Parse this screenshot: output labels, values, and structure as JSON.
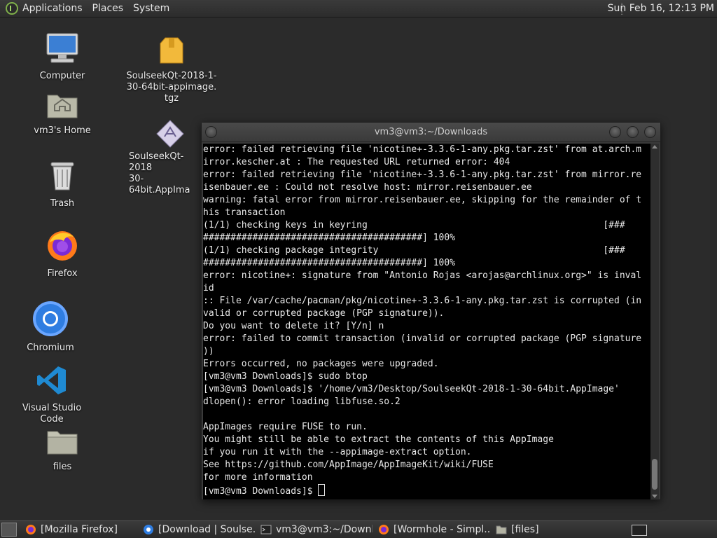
{
  "top_panel": {
    "menus": [
      "Applications",
      "Places",
      "System"
    ],
    "clock": "Sun Feb 16, 12:13 PM"
  },
  "desktop": {
    "computer": "Computer",
    "home": "vm3's Home",
    "trash": "Trash",
    "firefox": "Firefox",
    "chromium": "Chromium",
    "vscode": "Visual Studio Code",
    "files": "files",
    "tgz_line1": "SoulseekQt-2018-1-",
    "tgz_line2": "30-64bit-appimage.",
    "tgz_line3": "tgz",
    "appimage_line1": "SoulseekQt-2018",
    "appimage_line2": "30-64bit.AppIma"
  },
  "terminal": {
    "title": "vm3@vm3:~/Downloads",
    "lines": [
      "error: failed retrieving file 'nicotine+-3.3.6-1-any.pkg.tar.zst' from at.arch.m",
      "irror.kescher.at : The requested URL returned error: 404",
      "error: failed retrieving file 'nicotine+-3.3.6-1-any.pkg.tar.zst' from mirror.re",
      "isenbauer.ee : Could not resolve host: mirror.reisenbauer.ee",
      "warning: fatal error from mirror.reisenbauer.ee, skipping for the remainder of t",
      "his transaction",
      "(1/1) checking keys in keyring                                           [###",
      "########################################] 100%",
      "(1/1) checking package integrity                                         [###",
      "########################################] 100%",
      "error: nicotine+: signature from \"Antonio Rojas <arojas@archlinux.org>\" is inval",
      "id",
      ":: File /var/cache/pacman/pkg/nicotine+-3.3.6-1-any.pkg.tar.zst is corrupted (in",
      "valid or corrupted package (PGP signature)).",
      "Do you want to delete it? [Y/n] n",
      "error: failed to commit transaction (invalid or corrupted package (PGP signature",
      "))",
      "Errors occurred, no packages were upgraded.",
      "[vm3@vm3 Downloads]$ sudo btop",
      "[vm3@vm3 Downloads]$ '/home/vm3/Desktop/SoulseekQt-2018-1-30-64bit.AppImage'",
      "dlopen(): error loading libfuse.so.2",
      "",
      "AppImages require FUSE to run.",
      "You might still be able to extract the contents of this AppImage",
      "if you run it with the --appimage-extract option.",
      "See https://github.com/AppImage/AppImageKit/wiki/FUSE",
      "for more information"
    ],
    "prompt": "[vm3@vm3 Downloads]$ "
  },
  "taskbar": {
    "tasks": [
      "[Mozilla Firefox]",
      "[Download | Soulse...",
      "vm3@vm3:~/Downl...",
      "[Wormhole - Simpl...",
      "[files]"
    ]
  }
}
